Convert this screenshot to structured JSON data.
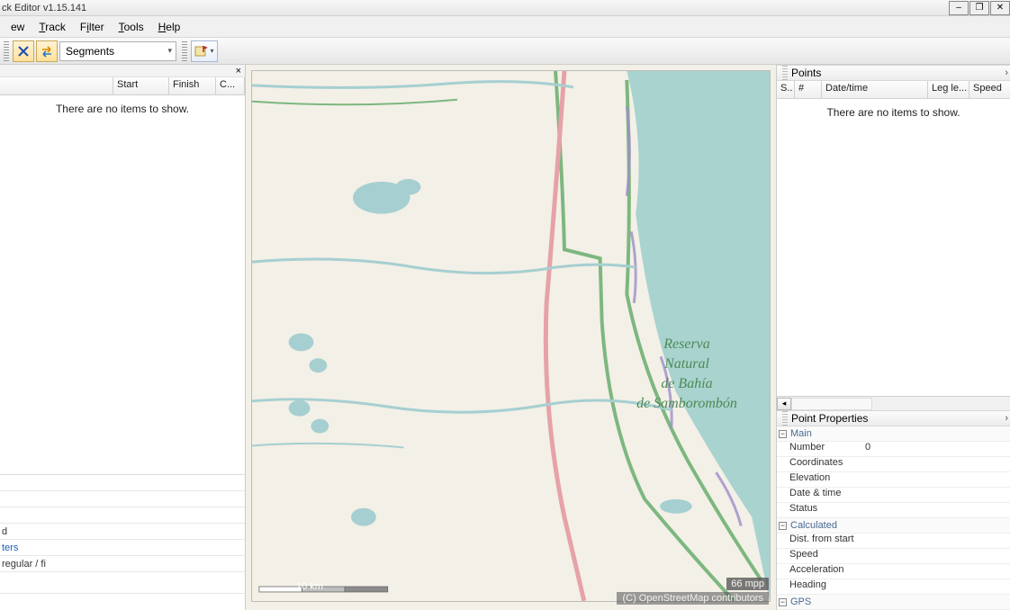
{
  "window": {
    "title": "ck Editor v1.15.141"
  },
  "menu": {
    "view": "ew",
    "track": "Track",
    "filter": "Filter",
    "tools": "Tools",
    "help": "Help"
  },
  "toolbar": {
    "dropdown": "Segments"
  },
  "left": {
    "columns": {
      "col1": "",
      "start": "Start",
      "finish": "Finish",
      "c": "C..."
    },
    "empty": "There are no items to show.",
    "bottom": {
      "row1": "d",
      "row2": "ters",
      "row3": "regular / fi"
    }
  },
  "right": {
    "points_title": "Points",
    "columns": {
      "s": "S..",
      "num": "#",
      "datetime": "Date/time",
      "leg": "Leg le...",
      "speed": "Speed"
    },
    "empty": "There are no items to show.",
    "props_title": "Point Properties",
    "groups": {
      "main": {
        "name": "Main",
        "rows": {
          "number": "Number",
          "coords": "Coordinates",
          "elev": "Elevation",
          "datetime": "Date & time",
          "status": "Status"
        },
        "vals": {
          "number": "0"
        }
      },
      "calc": {
        "name": "Calculated",
        "rows": {
          "dist": "Dist. from start",
          "speed": "Speed",
          "accel": "Acceleration",
          "heading": "Heading"
        }
      },
      "gps": {
        "name": "GPS"
      }
    }
  },
  "map": {
    "label_l1": "Reserva",
    "label_l2": "Natural",
    "label_l3": "de Bahía",
    "label_l4": "de Samborombón",
    "scale_text": "10 km",
    "mpp": "66 mpp",
    "attr": "(C) OpenStreetMap contributors"
  }
}
